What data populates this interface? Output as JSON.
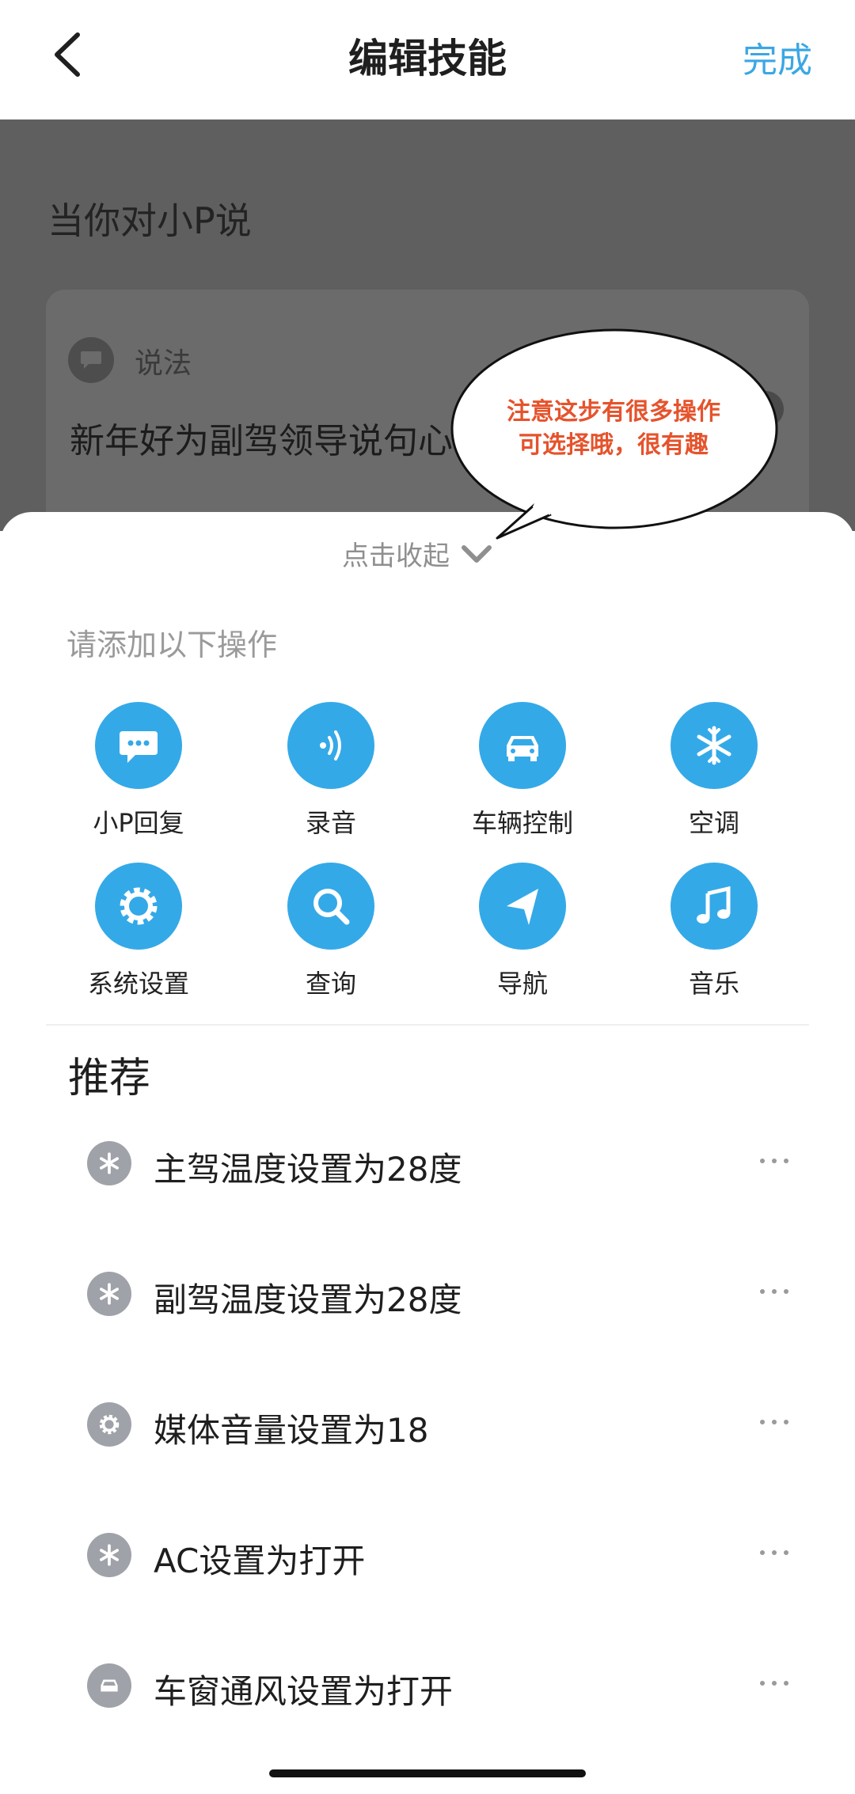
{
  "header": {
    "title": "编辑技能",
    "done_label": "完成"
  },
  "trigger": {
    "heading": "当你对小P说",
    "utterance_label": "说法",
    "utterance_text": "新年好为副驾领导说句心"
  },
  "callout": {
    "line1": "注意这步有很多操作",
    "line2": "可选择哦，很有趣"
  },
  "sheet": {
    "collapse_label": "点击收起",
    "section_label": "请添加以下操作",
    "actions": [
      {
        "label": "小P回复",
        "icon": "chat-bubble-icon"
      },
      {
        "label": "录音",
        "icon": "sound-wave-icon"
      },
      {
        "label": "车辆控制",
        "icon": "car-icon"
      },
      {
        "label": "空调",
        "icon": "snowflake-icon"
      },
      {
        "label": "系统设置",
        "icon": "gear-icon"
      },
      {
        "label": "查询",
        "icon": "search-icon"
      },
      {
        "label": "导航",
        "icon": "navigation-icon"
      },
      {
        "label": "音乐",
        "icon": "music-note-icon"
      }
    ],
    "recommend_title": "推荐",
    "recommendations": [
      {
        "text": "主驾温度设置为28度",
        "icon": "snowflake-icon"
      },
      {
        "text": "副驾温度设置为28度",
        "icon": "snowflake-icon"
      },
      {
        "text": "媒体音量设置为18",
        "icon": "gear-icon"
      },
      {
        "text": "AC设置为打开",
        "icon": "snowflake-icon"
      },
      {
        "text": "车窗通风设置为打开",
        "icon": "car-icon"
      }
    ]
  },
  "colors": {
    "accent": "#34a9e8",
    "done": "#3aa7e4",
    "callout_text": "#e5532c",
    "dim_overlay": "#5f5f5f"
  }
}
